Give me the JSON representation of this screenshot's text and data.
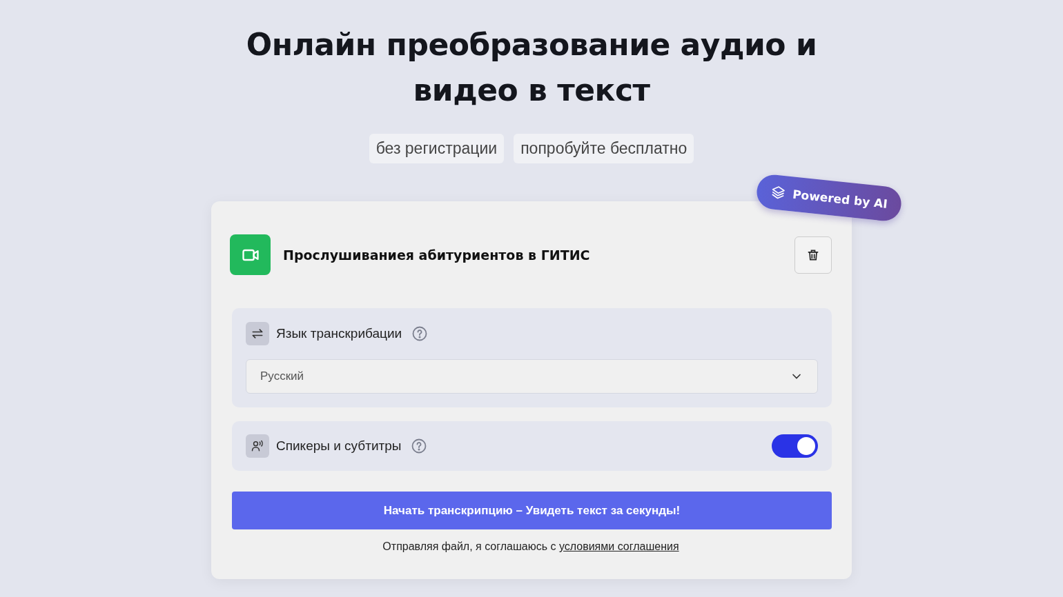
{
  "heading": {
    "lines": [
      "Онлайн преобразование аудио и",
      "видео в текст"
    ]
  },
  "tags": [
    "без регистрации",
    "попробуйте бесплатно"
  ],
  "badge": {
    "label": "Powered by AI"
  },
  "file": {
    "name": "Прослушиваниея абитуриентов в ГИТИС"
  },
  "language": {
    "label": "Язык транскрибации",
    "value": "Русский"
  },
  "speakers": {
    "label": "Спикеры и субтитры",
    "on": true
  },
  "start_button": {
    "label": "Начать транскрипцию – Увидеть текст за секунды!"
  },
  "consent": {
    "text": "Отправляя файл, я соглашаюсь с",
    "link": "условиями соглашения"
  }
}
